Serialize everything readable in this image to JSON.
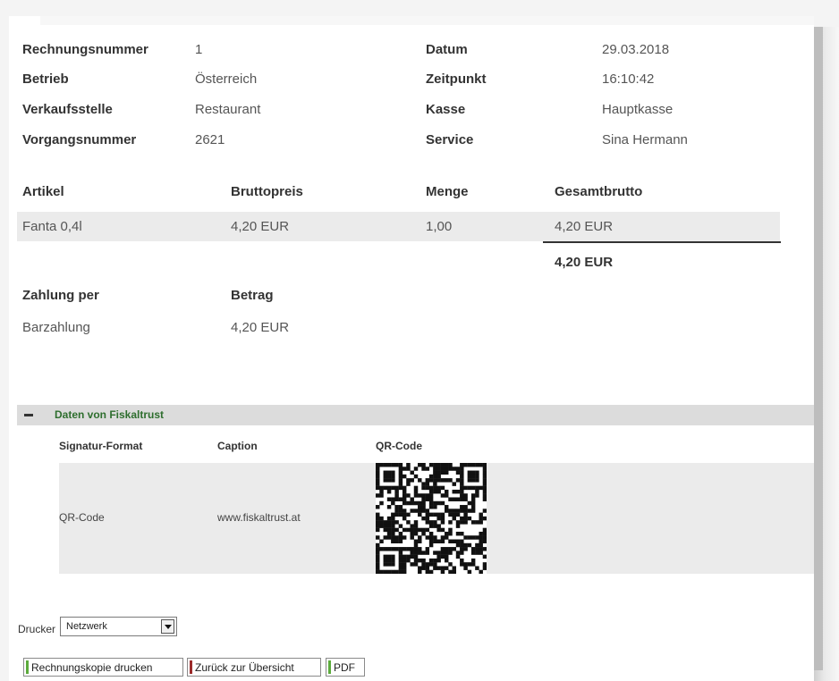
{
  "invoice": {
    "left": [
      {
        "label": "Rechnungsnummer",
        "value": "1"
      },
      {
        "label": "Betrieb",
        "value": "Österreich"
      },
      {
        "label": "Verkaufsstelle",
        "value": "Restaurant"
      },
      {
        "label": "Vorgangsnummer",
        "value": "2621"
      }
    ],
    "right": [
      {
        "label": "Datum",
        "value": "29.03.2018"
      },
      {
        "label": "Zeitpunkt",
        "value": "16:10:42"
      },
      {
        "label": "Kasse",
        "value": "Hauptkasse"
      },
      {
        "label": "Service",
        "value": "Sina Hermann"
      }
    ]
  },
  "items": {
    "headers": [
      "Artikel",
      "Bruttopreis",
      "Menge",
      "Gesamtbrutto"
    ],
    "rows": [
      [
        "Fanta 0,4l",
        "4,20 EUR",
        "1,00",
        "4,20 EUR"
      ]
    ],
    "total": "4,20 EUR"
  },
  "payment": {
    "headers": [
      "Zahlung per",
      "Betrag"
    ],
    "rows": [
      [
        "Barzahlung",
        "4,20 EUR"
      ]
    ]
  },
  "fiskaltrust": {
    "title": "Daten von Fiskaltrust",
    "headers": [
      "Signatur-Format",
      "Caption",
      "QR-Code"
    ],
    "row": {
      "format": "QR-Code",
      "caption": "www.fiskaltrust.at"
    }
  },
  "printer": {
    "label": "Drucker",
    "selected": "Netzwerk"
  },
  "actions": {
    "print_copy": "Rechnungskopie drucken",
    "back": "Zurück zur Übersicht",
    "pdf": "PDF"
  },
  "colors": {
    "accent_green": "#5cab3c",
    "accent_red": "#9b2a2a",
    "section_title": "#2e6e2e"
  }
}
